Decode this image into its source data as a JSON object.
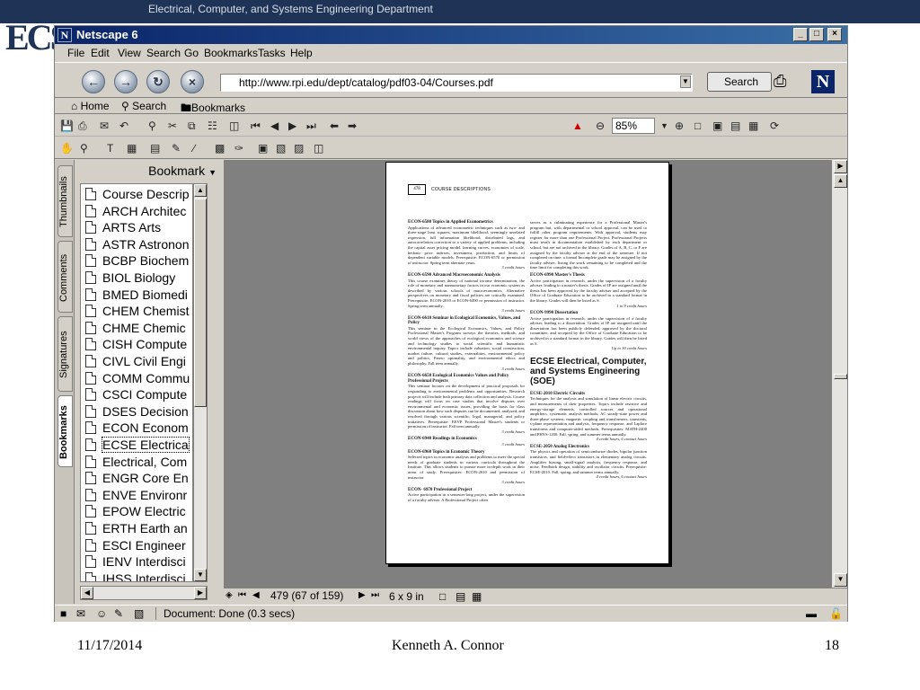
{
  "slide": {
    "department": "Electrical, Computer, and Systems Engineering Department",
    "footer_date": "11/17/2014",
    "footer_author": "Kenneth A. Connor",
    "footer_page": "18"
  },
  "window": {
    "title": "Netscape 6"
  },
  "menu": {
    "items": [
      "File",
      "Edit",
      "View",
      "Search",
      "Go",
      "Bookmarks",
      "Tasks",
      "Help"
    ]
  },
  "navbar": {
    "url": "http://www.rpi.edu/dept/catalog/pdf03-04/Courses.pdf",
    "search_label": "Search"
  },
  "personal_toolbar": {
    "home_label": "Home",
    "search_label": "Search",
    "bookmarks_label": "Bookmarks"
  },
  "acrobat": {
    "zoom": "85%",
    "page_field": "479",
    "page_count": "(67 of 159)",
    "page_size": "6 x 9 in"
  },
  "side_tabs": [
    "Thumbnails",
    "Comments",
    "Signatures",
    "Bookmarks"
  ],
  "bookmarks": {
    "header": "Bookmark",
    "items": [
      "Course Descrip",
      "ARCH Architec",
      "ARTS Arts",
      "ASTR Astronon",
      "BCBP Biochem",
      "BIOL Biology",
      "BMED Biomedi",
      "CHEM Chemist",
      "CHME Chemic",
      "CISH Compute",
      "CIVL Civil Engi",
      "COMM Commu",
      "CSCI Compute",
      "DSES Decision",
      "ECON Econom",
      "ECSE Electrica",
      "Electrical, Com",
      "ENGR Core En",
      "ENVE Environr",
      "EPOW Electric",
      "ERTH Earth an",
      "ESCI Engineer",
      "IENV Interdisci",
      "IHSS Interdisci"
    ]
  },
  "pdf_page": {
    "number": "478",
    "running_head": "COURSE DESCRIPTIONS",
    "left_column": [
      {
        "title": "ECON-6580 Topics in Applied Econometrics",
        "body": "Applications of advanced econometric techniques such as two- and three-stage least squares, maximum likelihood, seemingly unrelated regression, full information likelihood, distributed lags, and autocorrelation correction to a variety of applied problems, including the capital asset pricing model, learning curves, economies of scale, hedonic price indexes, investment, production, and limits of dependent variable models. Prerequisite: ECON-6570 or permission of instructor. Spring term alternate years.",
        "credits": "3 credit hours"
      },
      {
        "title": "ECON-6590 Advanced Macroeconomic Analysis",
        "body": "This course examines theory of national income determination, the role of monetary and nonmonetary factors in our economic system as described by various schools of macroeconomics. Alternative perspectives on monetary and fiscal policies are critically examined. Prerequisite: ECON-2010 or ECON-6490 or permission of instructor. Spring term annually.",
        "credits": "3 credit hours"
      },
      {
        "title": "ECON-6610 Seminar in Ecological Economics, Values, and Policy",
        "body": "This seminar in the Ecological Economics, Values, and Policy Professional Master's Program surveys the theories, methods, and world views of the approaches of ecological economics and science and technology studies to social scientific and humanistic environmental inquiry. Topics include valuation, social construction, market failure, cultural studies, externalities, environmental policy and politics, Pareto optimality, and environmental ethics and philosophy. Fall term annually.",
        "credits": "3 credit hours"
      },
      {
        "title": "ECON-6650 Ecological Economics Values and Policy Professional Projects",
        "body": "This seminar focuses on the development of practical proposals for responding to environmental problems and opportunities. Research projects will include both primary data collection and analysis. Course readings will focus on case studies that involve disputes over environmental and economic issues, providing the basis for class discussion about how such disputes can be documented, analyzed, and resolved through various scientific, legal, managerial, and policy initiatives. Prerequisite: EEVP Professional Master's students or permission of instructor. Fall term annually.",
        "credits": "3 credit hours"
      },
      {
        "title": "ECON-6940 Readings in Economics",
        "body": "",
        "credits": "3 credit hours"
      },
      {
        "title": "ECON-6960 Topics in Economic Theory",
        "body": "Selected topics in economic analysis and problems to meet the special needs of graduate students in various curricula throughout the Institute. This allows students to pursue more in-depth work in their areas of study. Prerequisites: ECON-2010 and permission of instructor.",
        "credits": "3 credit hours"
      },
      {
        "title": "ECON- 6970 Professional Project",
        "body": "Active participation in a semester-long project, under the supervision of a faculty adviser. A Professional Project often",
        "credits": ""
      }
    ],
    "right_column_intro": "serves as a culminating experience for a Professional Master's program but, with departmental or school approval, can be used to fulfill other program requirements. With approval, students may register for more than one Professional Project. Professional Projects must result in documentation established by each department or school, but are not archived in the library. Grades of A, B, C, or F are assigned by the faculty adviser at the end of the semester. If not completed on time, a formal Incomplete grade may be assigned by the faculty adviser, listing the work remaining to be completed and the time limit for completing this work.",
    "right_column": [
      {
        "title": "ECON-6990 Master's Thesis",
        "body": "Active participation in research, under the supervision of a faculty adviser, leading to a master's thesis. Grades of IP are assigned until the thesis has been approved by the faculty adviser and accepted by the Office of Graduate Education to be archived in a standard format in the library. Grades will then be listed as S.",
        "credits": "1 to 9 credit hours"
      },
      {
        "title": "ECON-9990 Dissertation",
        "body": "Active participation in research, under the supervision of a faculty adviser, leading to a dissertation. Grades of IP are assigned until the dissertation has been publicly defended, approved by the doctoral committee, and accepted by the Office of Graduate Education to be archived in a standard format in the library. Grades will then be listed as S.",
        "credits": "Up to 30 credit hours"
      }
    ],
    "section_heading": "ECSE Electrical, Computer, and Systems Engineering (SOE)",
    "section_courses": [
      {
        "title": "ECSE-2010 Electric Circuits",
        "body": "Techniques for the analysis and simulation of linear electric circuits, and measurements of their properties. Topics include resistive and energy-storage elements, controlled sources and operational amplifiers, systematic analysis methods, AC steady-state power and three-phase systems, magnetic coupling and transformers, transients, s-plane representation and analysis, frequency response, and Laplace transforms and computer-aided methods. Prerequisites: MATH-2400 and PHYS-1200. Fall, spring, and summer terms annually.",
        "credits": "4 credit hours, 6 contact hours"
      },
      {
        "title": "ECSE-2050 Analog Electronics",
        "body": "The physics and operation of semiconductor diodes, bipolar junction transistors, and field-effect transistors in elementary analog circuits. Amplifier biasing, small-signal analysis, frequency response, and noise. Feedback design, stability and oscillator circuits. Prerequisite: ECSE-2010. Fall, spring, and summer terms annually.",
        "credits": "4 credit hours, 6 contact hours"
      }
    ]
  },
  "status": {
    "text": "Document: Done (0.3 secs)"
  }
}
